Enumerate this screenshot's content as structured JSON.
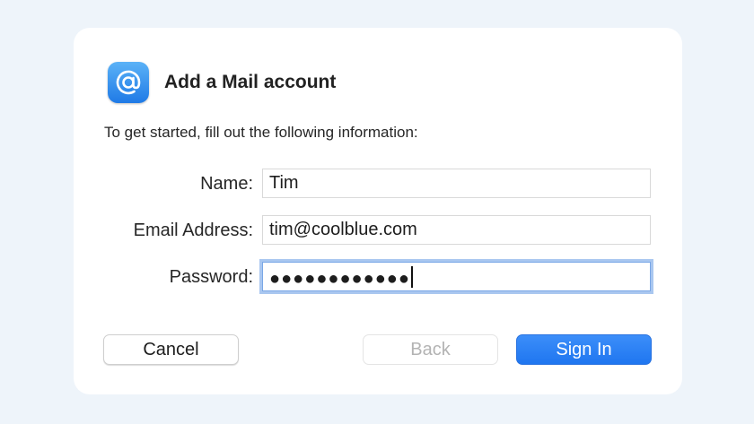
{
  "dialog": {
    "title": "Add a Mail account",
    "intro": "To get started, fill out the following information:",
    "app_icon": "at-sign-icon"
  },
  "form": {
    "name_label": "Name:",
    "name_value": "Tim",
    "email_label": "Email Address:",
    "email_value": "tim@coolblue.com",
    "password_label": "Password:",
    "password_masked": "●●●●●●●●●●●●"
  },
  "buttons": {
    "cancel": "Cancel",
    "back": "Back",
    "sign_in": "Sign In"
  },
  "colors": {
    "accent": "#1f76f0",
    "focus_ring": "#a9c7f0",
    "background": "#eef4fa"
  }
}
